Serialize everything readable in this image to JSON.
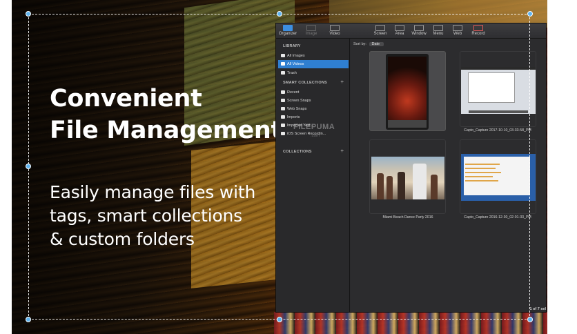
{
  "promo": {
    "headline_line1": "Convenient",
    "headline_line2": "File Management",
    "sub_line1": "Easily manage files with",
    "sub_line2": "tags, smart collections",
    "sub_line3": "& custom folders"
  },
  "toolbar": {
    "items": [
      {
        "label": "Organizer",
        "icon": "grid-icon"
      },
      {
        "label": "Image",
        "icon": "image-icon"
      },
      {
        "label": "Video",
        "icon": "video-icon"
      },
      {
        "label": "Screen",
        "icon": "screen-icon"
      },
      {
        "label": "Area",
        "icon": "area-icon"
      },
      {
        "label": "Window",
        "icon": "window-icon"
      },
      {
        "label": "Menu",
        "icon": "menu-icon"
      },
      {
        "label": "Web",
        "icon": "web-icon"
      },
      {
        "label": "Record",
        "icon": "record-icon"
      }
    ]
  },
  "sidebar": {
    "library_header": "LIBRARY",
    "library_items": [
      {
        "label": "All Images"
      },
      {
        "label": "All Videos"
      },
      {
        "label": "Trash"
      }
    ],
    "smart_header": "SMART COLLECTIONS",
    "smart_items": [
      {
        "label": "Recent"
      },
      {
        "label": "Screen Snaps"
      },
      {
        "label": "Web Snaps"
      },
      {
        "label": "Imports"
      },
      {
        "label": "Imported Yest..."
      },
      {
        "label": "iOS Screen Recordin..."
      }
    ],
    "collections_header": "COLLECTIONS",
    "plus": "+"
  },
  "content": {
    "sort_label": "Sort by:",
    "sort_value": "Date",
    "captions": [
      "",
      "Capto_Capture 2017-10-10_03-33-58_PM",
      "Miami Beach Dance Party 2016",
      "Capto_Capture 2016-12-30_02-01-33_PM"
    ],
    "footer": "1 of 7 sel"
  },
  "watermark": "FILEPUMA",
  "watermark_sub": ".com",
  "colors": {
    "accent": "#2f7fd1",
    "handle": "#5fb4f0",
    "app_bg": "#2b2b2d"
  }
}
